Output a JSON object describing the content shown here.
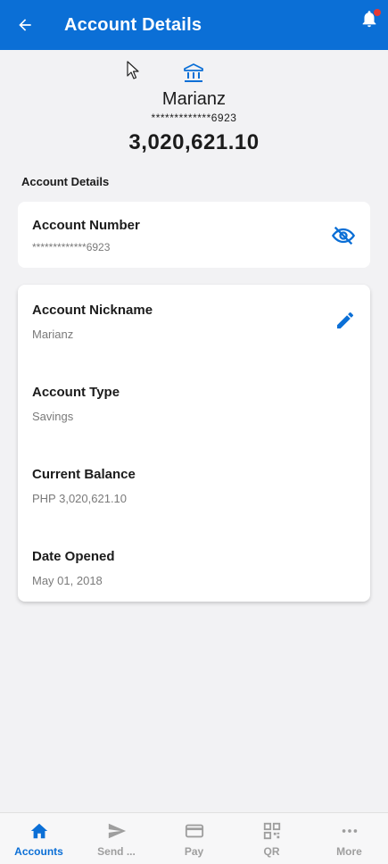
{
  "header": {
    "title": "Account Details"
  },
  "summary": {
    "name": "Marianz",
    "masked_number": "*************6923",
    "balance": "3,020,621.10"
  },
  "section_title": "Account Details",
  "card_number": {
    "label": "Account Number",
    "value": "*************6923"
  },
  "details": {
    "nickname_label": "Account Nickname",
    "nickname_value": "Marianz",
    "type_label": "Account Type",
    "type_value": "Savings",
    "balance_label": "Current Balance",
    "balance_value": "PHP 3,020,621.10",
    "opened_label": "Date Opened",
    "opened_value": "May 01, 2018"
  },
  "nav": {
    "items": [
      {
        "label": "Accounts",
        "icon": "home-icon",
        "active": true
      },
      {
        "label": "Send ...",
        "icon": "send-icon",
        "active": false
      },
      {
        "label": "Pay",
        "icon": "card-icon",
        "active": false
      },
      {
        "label": "QR",
        "icon": "qr-icon",
        "active": false
      },
      {
        "label": "More",
        "icon": "more-icon",
        "active": false
      }
    ]
  },
  "colors": {
    "brand": "#0b6fd6",
    "notification": "#e53935",
    "inactive": "#9e9e9e"
  }
}
